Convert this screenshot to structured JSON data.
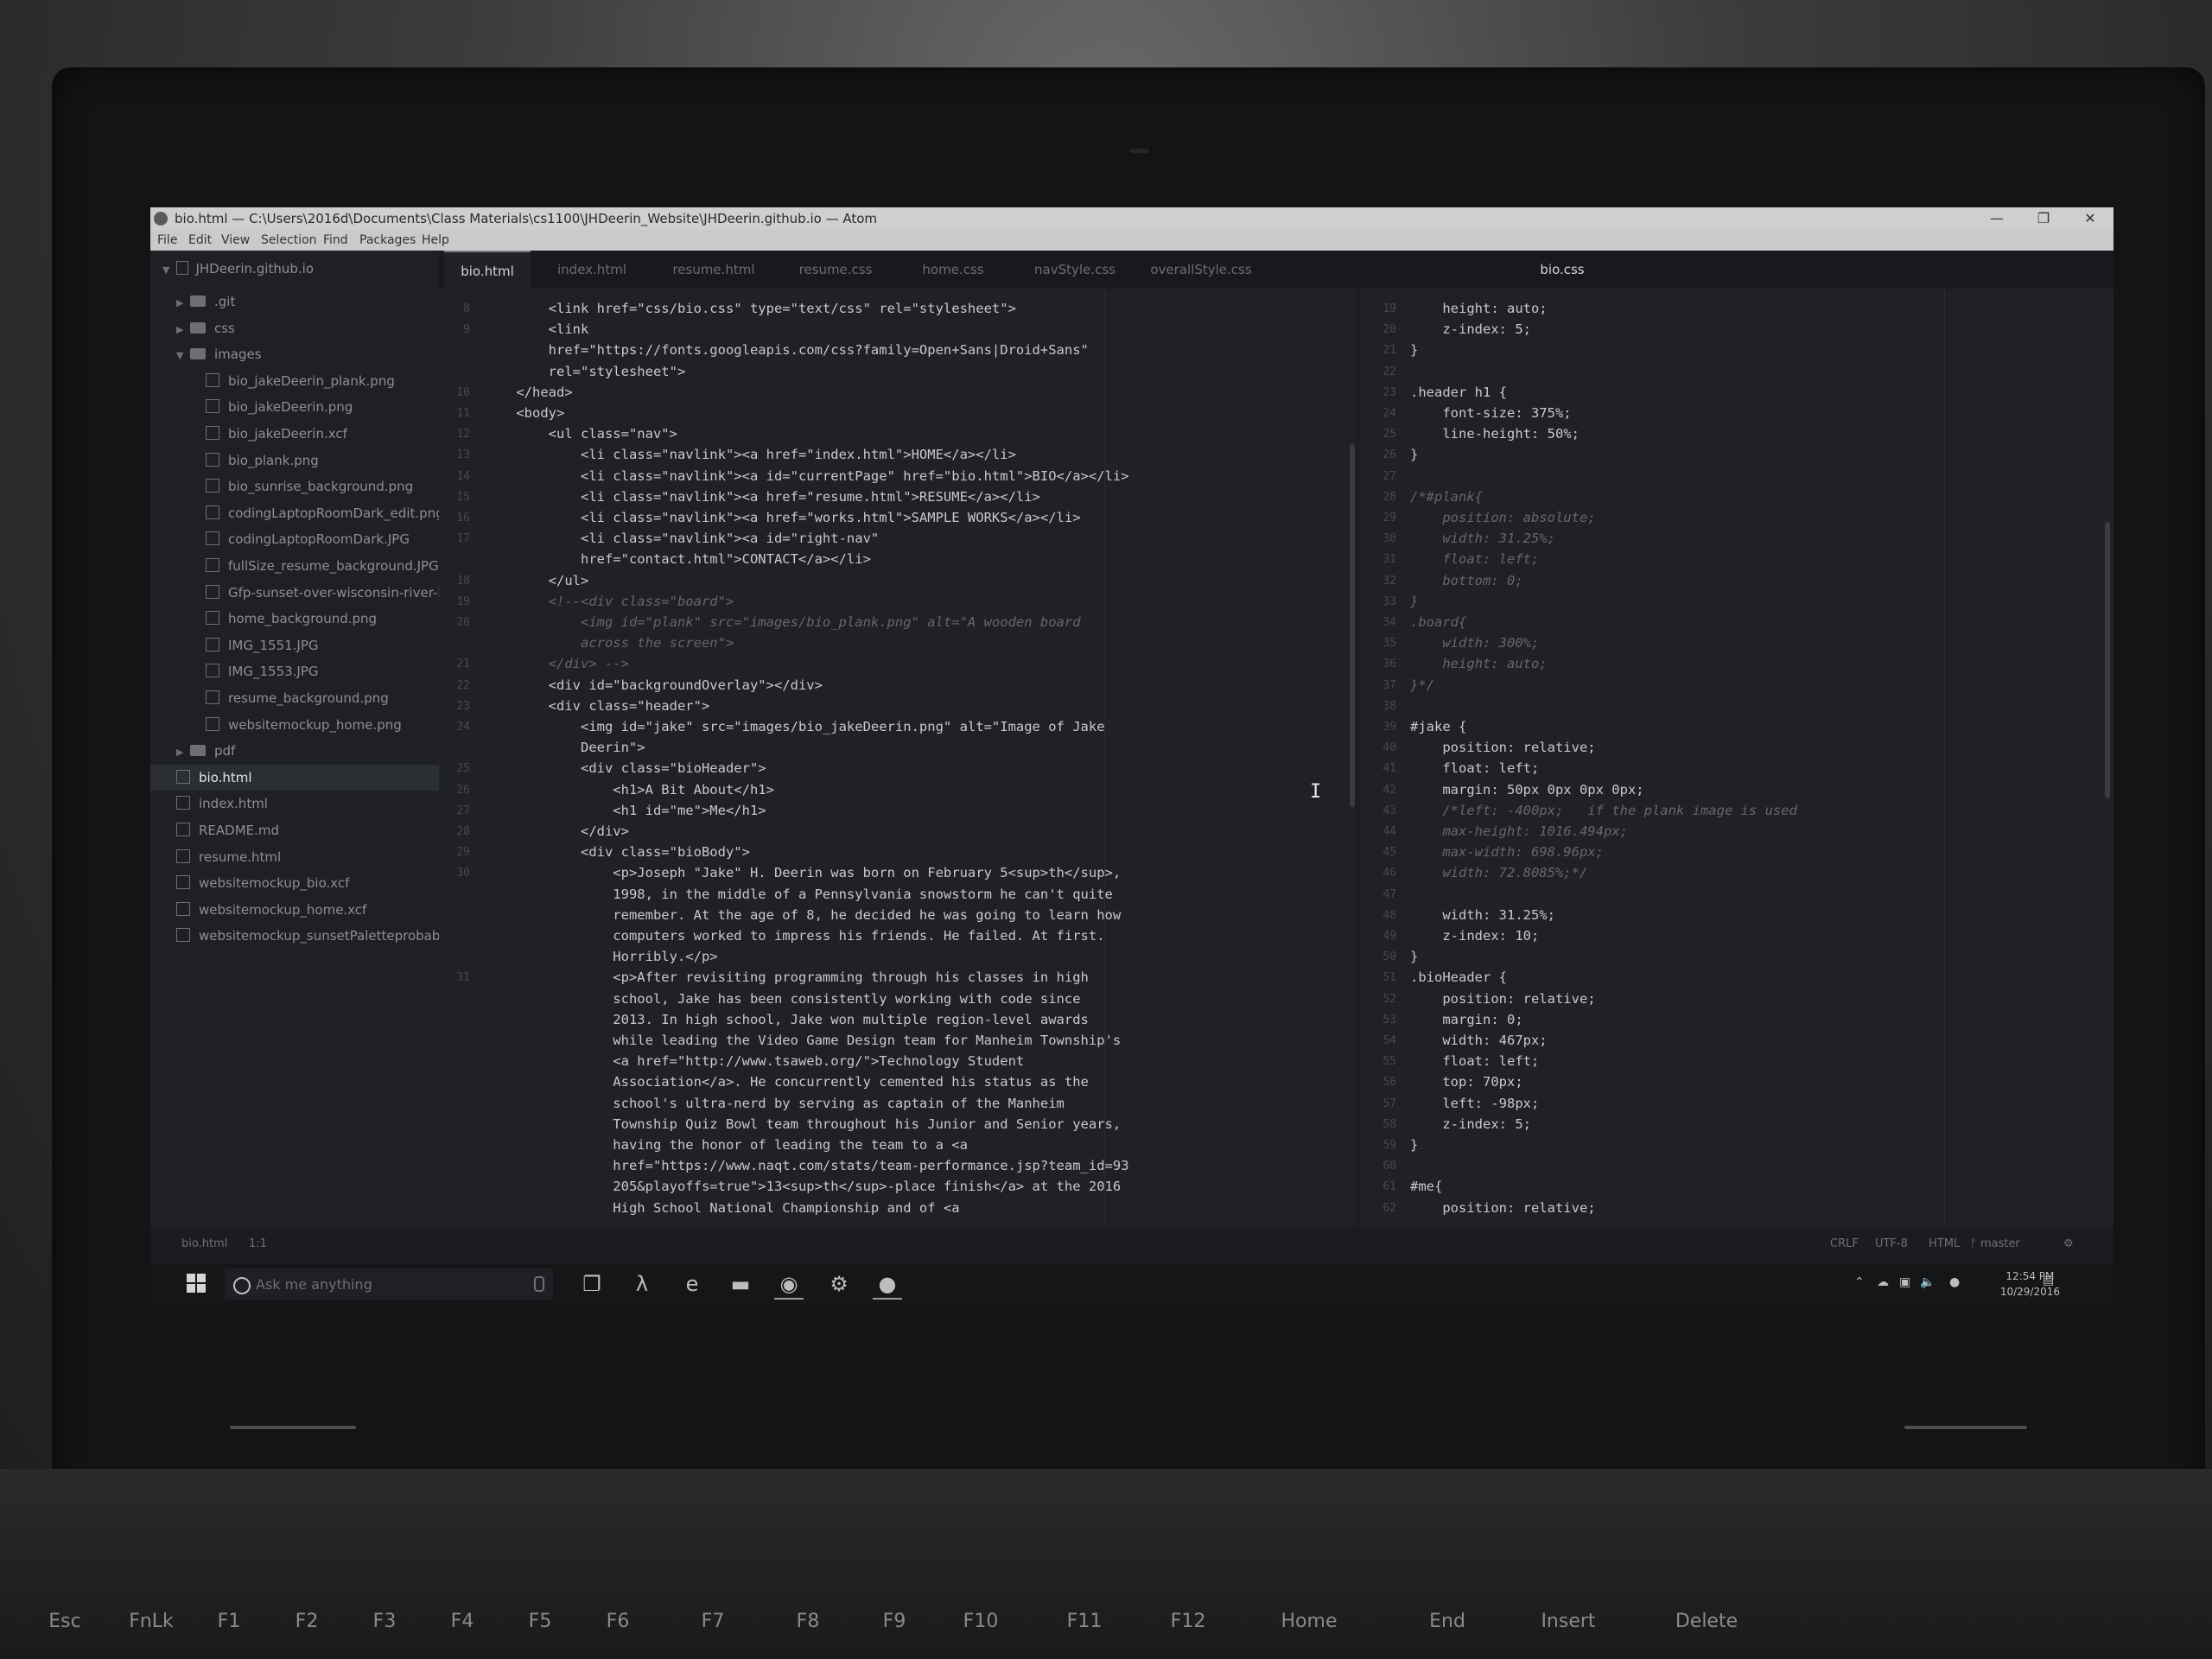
{
  "window": {
    "title": "bio.html — C:\\Users\\2016d\\Documents\\Class Materials\\cs1100\\JHDeerin_Website\\JHDeerin.github.io — Atom",
    "controls": {
      "minimize": "—",
      "restore": "❐",
      "close": "✕"
    }
  },
  "menu": [
    "File",
    "Edit",
    "View",
    "Selection",
    "Find",
    "Packages",
    "Help"
  ],
  "tree": {
    "root": "JHDeerin.github.io",
    "items": [
      {
        "label": ".git",
        "kind": "folder",
        "state": "collapsed",
        "indent": 1
      },
      {
        "label": "css",
        "kind": "folder",
        "state": "collapsed",
        "indent": 1
      },
      {
        "label": "images",
        "kind": "folder",
        "state": "expanded",
        "indent": 1
      },
      {
        "label": "bio_jakeDeerin_plank.png",
        "kind": "file",
        "indent": 2
      },
      {
        "label": "bio_jakeDeerin.png",
        "kind": "file",
        "indent": 2
      },
      {
        "label": "bio_jakeDeerin.xcf",
        "kind": "file",
        "indent": 2
      },
      {
        "label": "bio_plank.png",
        "kind": "file",
        "indent": 2
      },
      {
        "label": "bio_sunrise_background.png",
        "kind": "file",
        "indent": 2
      },
      {
        "label": "codingLaptopRoomDark_edit.png",
        "kind": "file",
        "indent": 2
      },
      {
        "label": "codingLaptopRoomDark.JPG",
        "kind": "file",
        "indent": 2
      },
      {
        "label": "fullSize_resume_background.JPG",
        "kind": "file",
        "indent": 2
      },
      {
        "label": "Gfp-sunset-over-wisconsin-river-in",
        "kind": "file",
        "indent": 2
      },
      {
        "label": "home_background.png",
        "kind": "file",
        "indent": 2
      },
      {
        "label": "IMG_1551.JPG",
        "kind": "file",
        "indent": 2
      },
      {
        "label": "IMG_1553.JPG",
        "kind": "file",
        "indent": 2
      },
      {
        "label": "resume_background.png",
        "kind": "file",
        "indent": 2
      },
      {
        "label": "websitemockup_home.png",
        "kind": "file",
        "indent": 2
      },
      {
        "label": "pdf",
        "kind": "folder",
        "state": "collapsed",
        "indent": 1
      },
      {
        "label": "bio.html",
        "kind": "file",
        "indent": 1,
        "selected": true
      },
      {
        "label": "index.html",
        "kind": "file",
        "indent": 1
      },
      {
        "label": "README.md",
        "kind": "file",
        "indent": 1
      },
      {
        "label": "resume.html",
        "kind": "file",
        "indent": 1
      },
      {
        "label": "websitemockup_bio.xcf",
        "kind": "file",
        "indent": 1
      },
      {
        "label": "websitemockup_home.xcf",
        "kind": "file",
        "indent": 1
      },
      {
        "label": "websitemockup_sunsetPaletteprobabl",
        "kind": "file",
        "indent": 1
      }
    ]
  },
  "tabs": {
    "left": [
      {
        "label": "bio.html",
        "active": true
      },
      {
        "label": "index.html",
        "active": false
      },
      {
        "label": "resume.html",
        "active": false
      },
      {
        "label": "resume.css",
        "active": false
      },
      {
        "label": "home.css",
        "active": false
      },
      {
        "label": "navStyle.css",
        "active": false
      },
      {
        "label": "overallStyle.css",
        "active": false
      }
    ],
    "right": [
      {
        "label": "bio.css",
        "active": true
      }
    ]
  },
  "editor_left": {
    "lines": [
      {
        "num": "8",
        "text": "        <link href=\"css/bio.css\" type=\"text/css\" rel=\"stylesheet\">"
      },
      {
        "num": "9",
        "text": "        <link"
      },
      {
        "num": "",
        "text": "        href=\"https://fonts.googleapis.com/css?family=Open+Sans|Droid+Sans\""
      },
      {
        "num": "",
        "text": "        rel=\"stylesheet\">"
      },
      {
        "num": "10",
        "text": "    </head>"
      },
      {
        "num": "11",
        "text": "    <body>"
      },
      {
        "num": "12",
        "text": "        <ul class=\"nav\">"
      },
      {
        "num": "13",
        "text": "            <li class=\"navlink\"><a href=\"index.html\">HOME</a></li>"
      },
      {
        "num": "14",
        "text": "            <li class=\"navlink\"><a id=\"currentPage\" href=\"bio.html\">BIO</a></li>"
      },
      {
        "num": "15",
        "text": "            <li class=\"navlink\"><a href=\"resume.html\">RESUME</a></li>"
      },
      {
        "num": "16",
        "text": "            <li class=\"navlink\"><a href=\"works.html\">SAMPLE WORKS</a></li>"
      },
      {
        "num": "17",
        "text": "            <li class=\"navlink\"><a id=\"right-nav\""
      },
      {
        "num": "",
        "text": "            href=\"contact.html\">CONTACT</a></li>"
      },
      {
        "num": "18",
        "text": "        </ul>"
      },
      {
        "num": "19",
        "text": "        <!--<div class=\"board\">",
        "dim": true
      },
      {
        "num": "20",
        "text": "            <img id=\"plank\" src=\"images/bio_plank.png\" alt=\"A wooden board",
        "dim": true
      },
      {
        "num": "",
        "text": "            across the screen\">",
        "dim": true
      },
      {
        "num": "21",
        "text": "        </div> -->",
        "dim": true
      },
      {
        "num": "22",
        "text": "        <div id=\"backgroundOverlay\"></div>"
      },
      {
        "num": "23",
        "text": "        <div class=\"header\">"
      },
      {
        "num": "24",
        "text": "            <img id=\"jake\" src=\"images/bio_jakeDeerin.png\" alt=\"Image of Jake"
      },
      {
        "num": "",
        "text": "            Deerin\">"
      },
      {
        "num": "25",
        "text": "            <div class=\"bioHeader\">"
      },
      {
        "num": "26",
        "text": "                <h1>A Bit About</h1>"
      },
      {
        "num": "27",
        "text": "                <h1 id=\"me\">Me</h1>"
      },
      {
        "num": "28",
        "text": "            </div>"
      },
      {
        "num": "29",
        "text": "            <div class=\"bioBody\">"
      },
      {
        "num": "30",
        "text": "                <p>Joseph \"Jake\" H. Deerin was born on February 5<sup>th</sup>,"
      },
      {
        "num": "",
        "text": "                1998, in the middle of a Pennsylvania snowstorm he can't quite"
      },
      {
        "num": "",
        "text": "                remember. At the age of 8, he decided he was going to learn how"
      },
      {
        "num": "",
        "text": "                computers worked to impress his friends. He failed. At first."
      },
      {
        "num": "",
        "text": "                Horribly.</p>"
      },
      {
        "num": "31",
        "text": "                <p>After revisiting programming through his classes in high"
      },
      {
        "num": "",
        "text": "                school, Jake has been consistently working with code since"
      },
      {
        "num": "",
        "text": "                2013. In high school, Jake won multiple region-level awards"
      },
      {
        "num": "",
        "text": "                while leading the Video Game Design team for Manheim Township's"
      },
      {
        "num": "",
        "text": "                <a href=\"http://www.tsaweb.org/\">Technology Student"
      },
      {
        "num": "",
        "text": "                Association</a>. He concurrently cemented his status as the"
      },
      {
        "num": "",
        "text": "                school's ultra-nerd by serving as captain of the Manheim"
      },
      {
        "num": "",
        "text": "                Township Quiz Bowl team throughout his Junior and Senior years,"
      },
      {
        "num": "",
        "text": "                having the honor of leading the team to a <a"
      },
      {
        "num": "",
        "text": "                href=\"https://www.naqt.com/stats/team-performance.jsp?team_id=93"
      },
      {
        "num": "",
        "text": "                205&playoffs=true\">13<sup>th</sup>-place finish</a> at the 2016"
      },
      {
        "num": "",
        "text": "                High School National Championship and of <a"
      }
    ]
  },
  "editor_right": {
    "lines": [
      {
        "num": "19",
        "text": "    height: auto;"
      },
      {
        "num": "20",
        "text": "    z-index: 5;"
      },
      {
        "num": "21",
        "text": "}"
      },
      {
        "num": "22",
        "text": ""
      },
      {
        "num": "23",
        "text": ".header h1 {"
      },
      {
        "num": "24",
        "text": "    font-size: 375%;"
      },
      {
        "num": "25",
        "text": "    line-height: 50%;"
      },
      {
        "num": "26",
        "text": "}"
      },
      {
        "num": "27",
        "text": ""
      },
      {
        "num": "28",
        "text": "/*#plank{",
        "dim": true
      },
      {
        "num": "29",
        "text": "    position: absolute;",
        "dim": true
      },
      {
        "num": "30",
        "text": "    width: 31.25%;",
        "dim": true
      },
      {
        "num": "31",
        "text": "    float: left;",
        "dim": true
      },
      {
        "num": "32",
        "text": "    bottom: 0;",
        "dim": true
      },
      {
        "num": "33",
        "text": "}",
        "dim": true
      },
      {
        "num": "34",
        "text": ".board{",
        "dim": true
      },
      {
        "num": "35",
        "text": "    width: 300%;",
        "dim": true
      },
      {
        "num": "36",
        "text": "    height: auto;",
        "dim": true
      },
      {
        "num": "37",
        "text": "}*/",
        "dim": true
      },
      {
        "num": "38",
        "text": ""
      },
      {
        "num": "39",
        "text": "#jake {"
      },
      {
        "num": "40",
        "text": "    position: relative;"
      },
      {
        "num": "41",
        "text": "    float: left;"
      },
      {
        "num": "42",
        "text": "    margin: 50px 0px 0px 0px;"
      },
      {
        "num": "43",
        "text": "    /*left: -400px;   if the plank image is used",
        "dim": true
      },
      {
        "num": "44",
        "text": "    max-height: 1016.494px;",
        "dim": true
      },
      {
        "num": "45",
        "text": "    max-width: 698.96px;",
        "dim": true
      },
      {
        "num": "46",
        "text": "    width: 72.8085%;*/",
        "dim": true
      },
      {
        "num": "47",
        "text": ""
      },
      {
        "num": "48",
        "text": "    width: 31.25%;"
      },
      {
        "num": "49",
        "text": "    z-index: 10;"
      },
      {
        "num": "50",
        "text": "}"
      },
      {
        "num": "51",
        "text": ".bioHeader {"
      },
      {
        "num": "52",
        "text": "    position: relative;"
      },
      {
        "num": "53",
        "text": "    margin: 0;"
      },
      {
        "num": "54",
        "text": "    width: 467px;"
      },
      {
        "num": "55",
        "text": "    float: left;"
      },
      {
        "num": "56",
        "text": "    top: 70px;"
      },
      {
        "num": "57",
        "text": "    left: -98px;"
      },
      {
        "num": "58",
        "text": "    z-index: 5;"
      },
      {
        "num": "59",
        "text": "}"
      },
      {
        "num": "60",
        "text": ""
      },
      {
        "num": "61",
        "text": "#me{"
      },
      {
        "num": "62",
        "text": "    position: relative;"
      }
    ]
  },
  "status": {
    "file": "bio.html",
    "cursor": "1:1",
    "line_ending": "CRLF",
    "encoding": "UTF-8",
    "grammar": "HTML",
    "branch": "master"
  },
  "taskbar": {
    "search_placeholder": "Ask me anything",
    "time": "12:54 PM",
    "date": "10/29/2016"
  },
  "keyboard": {
    "keys": [
      "Esc",
      "FnLk",
      "F1",
      "F2",
      "F3",
      "F4",
      "F5",
      "F6",
      "F7",
      "F8",
      "F9",
      "F10",
      "F11",
      "F12",
      "Home",
      "End",
      "Insert",
      "Delete"
    ]
  }
}
